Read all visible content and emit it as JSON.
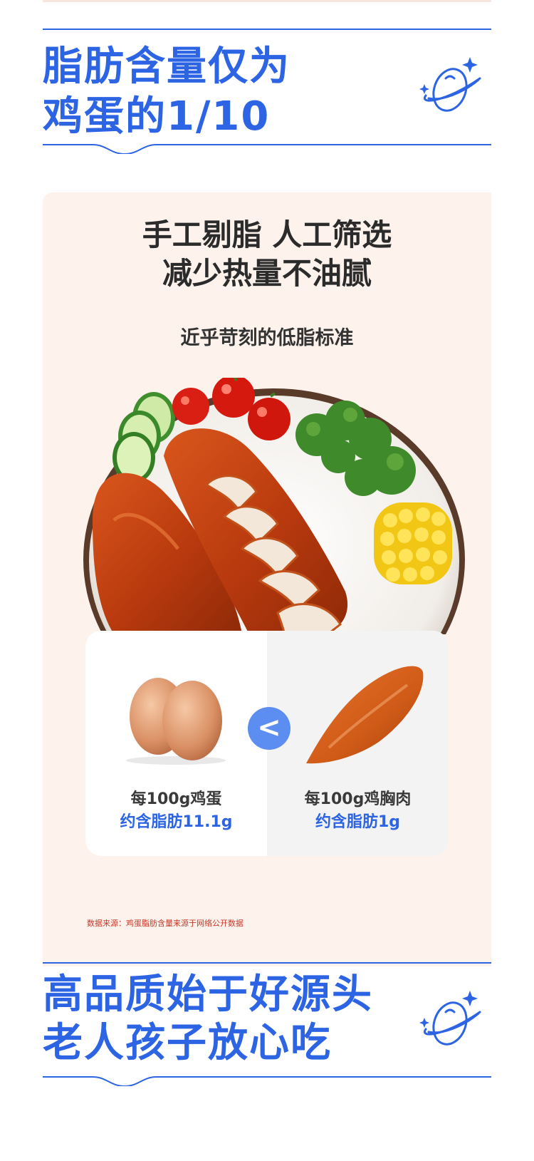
{
  "colors": {
    "accent": "#2c64e3",
    "panel_bg": "#fdf2ec",
    "note_red": "#c53a2a",
    "badge": "#5b8ef0"
  },
  "section1": {
    "title_lines": [
      "脂肪含量仅为",
      "鸡蛋的1/10"
    ],
    "deco_icon": "planet-icon"
  },
  "panel": {
    "headline_lines": [
      "手工剔脂  人工筛选",
      "减少热量不油腻"
    ],
    "subhead": "近乎苛刻的低脂标准",
    "comparison": {
      "symbol": "<",
      "left": {
        "icon": "eggs-icon",
        "line1": "每100g鸡蛋",
        "line2": "约含脂肪11.1g"
      },
      "right": {
        "icon": "chicken-breast-icon",
        "line1": "每100g鸡胸肉",
        "line2": "约含脂肪1g"
      }
    },
    "source_note": "数据来源：鸡蛋脂肪含量来源于网络公开数据"
  },
  "section2": {
    "title_lines": [
      "高品质始于好源头",
      "老人孩子放心吃"
    ],
    "deco_icon": "planet-icon"
  }
}
